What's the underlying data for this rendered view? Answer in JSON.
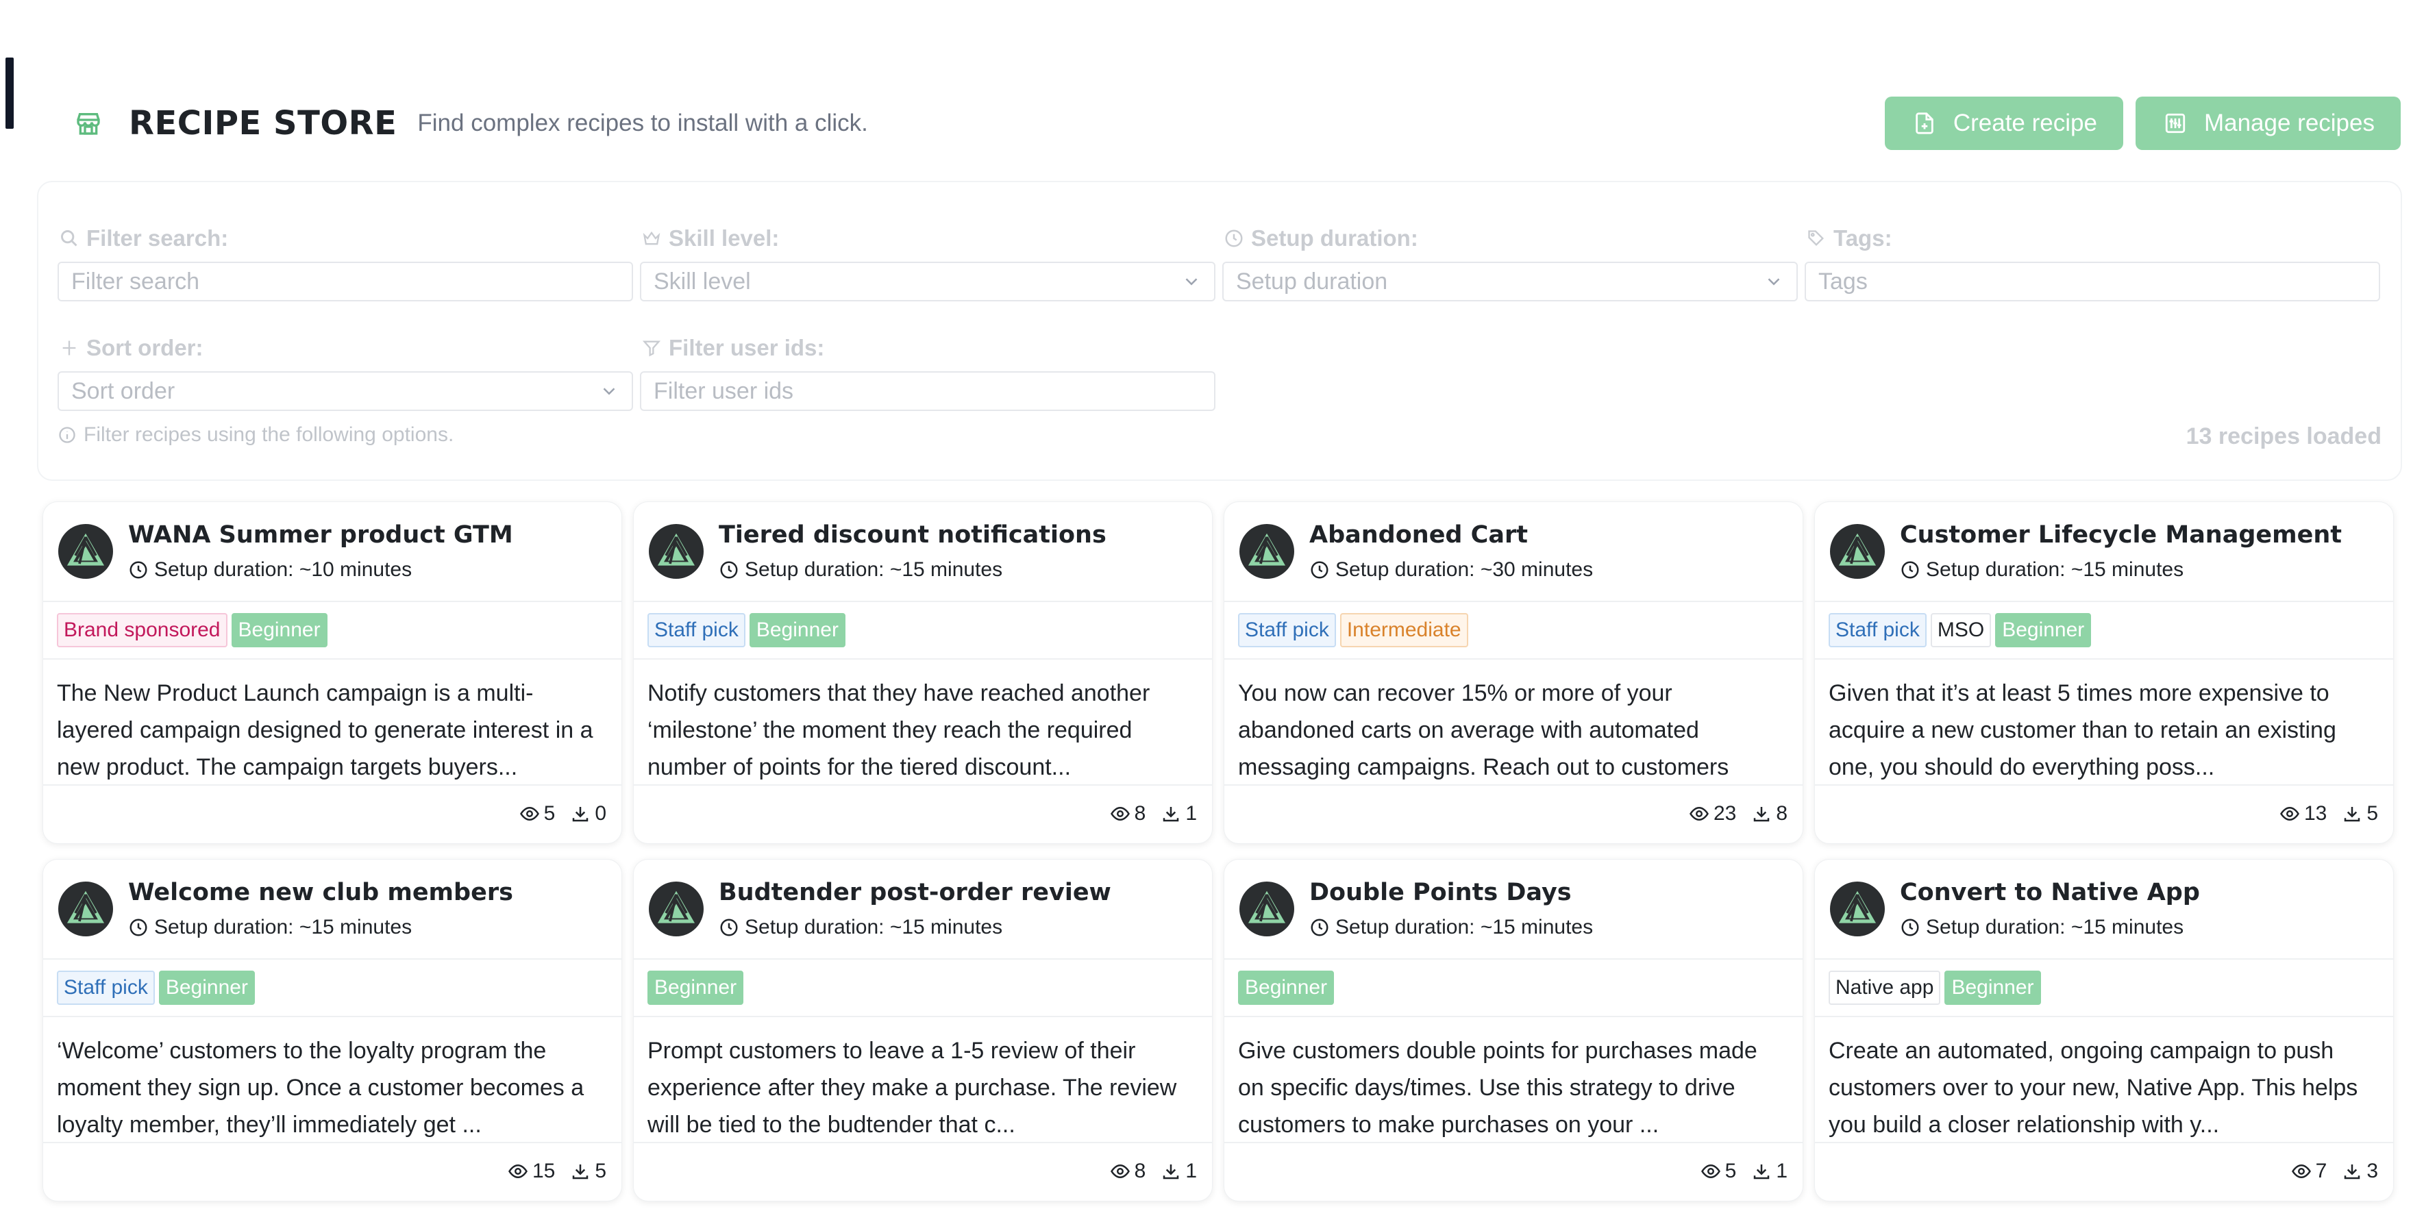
{
  "header": {
    "title": "RECIPE STORE",
    "subtitle": "Find complex recipes to install with a click.",
    "create_label": "Create recipe",
    "manage_label": "Manage recipes",
    "icons": {
      "store": "store-icon",
      "create": "file-plus-icon",
      "manage": "sliders-icon"
    }
  },
  "colors": {
    "accent": "#8fd4a6",
    "brand_sponsored": "#c2185b",
    "staff_pick": "#2f6fb8",
    "intermediate": "#d9822b"
  },
  "filters": {
    "search": {
      "label": "Filter search:",
      "placeholder": "Filter search"
    },
    "skill": {
      "label": "Skill level:",
      "placeholder": "Skill level"
    },
    "duration": {
      "label": "Setup duration:",
      "placeholder": "Setup duration"
    },
    "tags": {
      "label": "Tags:",
      "placeholder": "Tags"
    },
    "sort": {
      "label": "Sort order:",
      "placeholder": "Sort order"
    },
    "userids": {
      "label": "Filter user ids:",
      "placeholder": "Filter user ids"
    },
    "help": "Filter recipes using the following options.",
    "count": "13 recipes loaded"
  },
  "cards": [
    {
      "title": "WANA Summer product GTM",
      "duration": "Setup duration: ~10 minutes",
      "tags": [
        {
          "label": "Brand sponsored",
          "kind": "brand"
        },
        {
          "label": "Beginner",
          "kind": "beginner"
        }
      ],
      "desc": "The New Product Launch campaign is a multi-layered campaign designed to generate interest in a new product. The campaign targets buyers...",
      "views": "5",
      "installs": "0"
    },
    {
      "title": "Tiered discount notifications",
      "duration": "Setup duration: ~15 minutes",
      "tags": [
        {
          "label": "Staff pick",
          "kind": "staff"
        },
        {
          "label": "Beginner",
          "kind": "beginner"
        }
      ],
      "desc": "Notify customers that they have reached another ‘milestone’ the moment they reach the required number of points for the tiered discount...",
      "views": "8",
      "installs": "1"
    },
    {
      "title": "Abandoned Cart",
      "duration": "Setup duration: ~30 minutes",
      "tags": [
        {
          "label": "Staff pick",
          "kind": "staff"
        },
        {
          "label": "Intermediate",
          "kind": "intermediate"
        }
      ],
      "desc": "You now can recover 15% or more of your abandoned carts on average with automated messaging campaigns. Reach out to customers",
      "views": "23",
      "installs": "8"
    },
    {
      "title": "Customer Lifecycle Management",
      "duration": "Setup duration: ~15 minutes",
      "tags": [
        {
          "label": "Staff pick",
          "kind": "staff"
        },
        {
          "label": "MSO",
          "kind": "neutral"
        },
        {
          "label": "Beginner",
          "kind": "beginner"
        }
      ],
      "desc": "Given that it’s at least 5 times more expensive to acquire a new customer than to retain an existing one, you should do everything poss...",
      "views": "13",
      "installs": "5"
    },
    {
      "title": "Welcome new club members",
      "duration": "Setup duration: ~15 minutes",
      "tags": [
        {
          "label": "Staff pick",
          "kind": "staff"
        },
        {
          "label": "Beginner",
          "kind": "beginner"
        }
      ],
      "desc": "‘Welcome’ customers to the loyalty program the moment they sign up. Once a customer becomes a loyalty member, they’ll immediately get ...",
      "views": "15",
      "installs": "5"
    },
    {
      "title": "Budtender post-order review",
      "duration": "Setup duration: ~15 minutes",
      "tags": [
        {
          "label": "Beginner",
          "kind": "beginner"
        }
      ],
      "desc": "Prompt customers to leave a 1-5 review of their experience after they make a purchase. The review will be tied to the budtender that c...",
      "views": "8",
      "installs": "1"
    },
    {
      "title": "Double Points Days",
      "duration": "Setup duration: ~15 minutes",
      "tags": [
        {
          "label": "Beginner",
          "kind": "beginner"
        }
      ],
      "desc": "Give customers double points for purchases made on specific days/times. Use this strategy to drive customers to make purchases on your ...",
      "views": "5",
      "installs": "1"
    },
    {
      "title": "Convert to Native App",
      "duration": "Setup duration: ~15 minutes",
      "tags": [
        {
          "label": "Native app",
          "kind": "neutral"
        },
        {
          "label": "Beginner",
          "kind": "beginner"
        }
      ],
      "desc": "Create an automated, ongoing campaign to push customers over to your new, Native App. This helps you build a closer relationship with y...",
      "views": "7",
      "installs": "3"
    }
  ]
}
